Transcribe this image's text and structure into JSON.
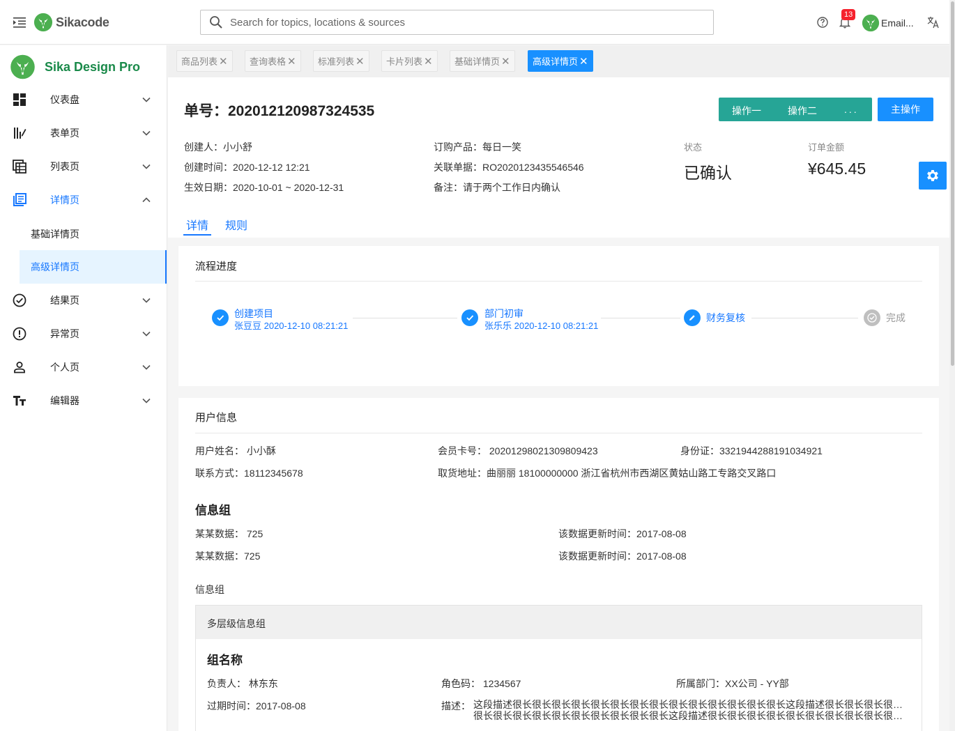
{
  "header": {
    "brand_name": "Sikacode",
    "search_placeholder": "Search for topics, locations & sources",
    "notification_count": "13",
    "user_name": "Email..."
  },
  "sidebar": {
    "title": "Sika Design Pro",
    "items": [
      {
        "label": "仪表盘"
      },
      {
        "label": "表单页"
      },
      {
        "label": "列表页"
      },
      {
        "label": "详情页"
      },
      {
        "label": "结果页"
      },
      {
        "label": "异常页"
      },
      {
        "label": "个人页"
      },
      {
        "label": "编辑器"
      }
    ],
    "sub_items": [
      {
        "label": "基础详情页"
      },
      {
        "label": "高级详情页"
      }
    ]
  },
  "tabs": [
    {
      "label": "商品列表"
    },
    {
      "label": "查询表格"
    },
    {
      "label": "标准列表"
    },
    {
      "label": "卡片列表"
    },
    {
      "label": "基础详情页"
    },
    {
      "label": "高级详情页"
    }
  ],
  "page": {
    "order_no": "单号：202012120987324535",
    "action_1": "操作一",
    "action_2": "操作二",
    "more": "...",
    "primary": "主操作",
    "creator": "创建人：",
    "creator_value": "小小舒",
    "created_at": "创建时间：",
    "created_at_value": "2020-12-12 12:21",
    "effective": "生效日期：",
    "effective_value": "2020-10-01 ~ 2020-12-31",
    "product": "订购产品：",
    "product_value": "每日一笑",
    "related": "关联单据：",
    "related_value": "RO2020123435546546",
    "remark": "备注：",
    "remark_value": "请于两个工作日内确认",
    "status_label": "状态",
    "status_value": "已确认",
    "amount_label": "订单金额",
    "amount_value": "¥645.45",
    "tab_detail": "详情",
    "tab_rules": "规则"
  },
  "progress": {
    "title": "流程进度",
    "steps": [
      {
        "title": "创建项目",
        "sub": "张豆豆 2020-12-10 08:21:21"
      },
      {
        "title": "部门初审",
        "sub": "张乐乐 2020-12-10 08:21:21"
      },
      {
        "title": "财务复核",
        "sub": ""
      },
      {
        "title": "完成",
        "sub": ""
      }
    ]
  },
  "user_info": {
    "title": "用户信息",
    "name": "用户姓名：",
    "name_value": "小小酥",
    "card_no": "会员卡号：",
    "card_no_value": "20201298021309809423",
    "id_card": "身份证：",
    "id_card_value": "3321944288191034921",
    "contact": "联系方式：",
    "contact_value": "18112345678",
    "address": "取货地址：",
    "address_value": "曲丽丽 18100000000 浙江省杭州市西湖区黄姑山路工专路交叉路口",
    "group_title": "信息组",
    "data_1": "某某数据：",
    "data_1_value": "725",
    "update_1": "该数据更新时间：",
    "update_1_value": "2017-08-08",
    "data_2": "某某数据：",
    "data_2_value": "725",
    "update_2": "该数据更新时间：",
    "update_2_value": "2017-08-08",
    "group_label": "信息组",
    "multi_title": "多层级信息组",
    "group_name": "组名称",
    "owner": "负责人：",
    "owner_value": "林东东",
    "role_code": "角色码：",
    "role_code_value": "1234567",
    "dept": "所属部门：",
    "dept_value": "XX公司 - YY部",
    "expire": "过期时间：",
    "expire_value": "2017-08-08",
    "description": "描述：",
    "description_line_1": "这段描述很长很长很长很长很长很长很长很长很长很长很长很长很长很长这段描述很长很长很长很长很长",
    "description_line_2": "很长很长很长很长很长很长很长很长很长很长这段描述很长很长很长很长很长很长很长很长很长很长很长很..."
  }
}
